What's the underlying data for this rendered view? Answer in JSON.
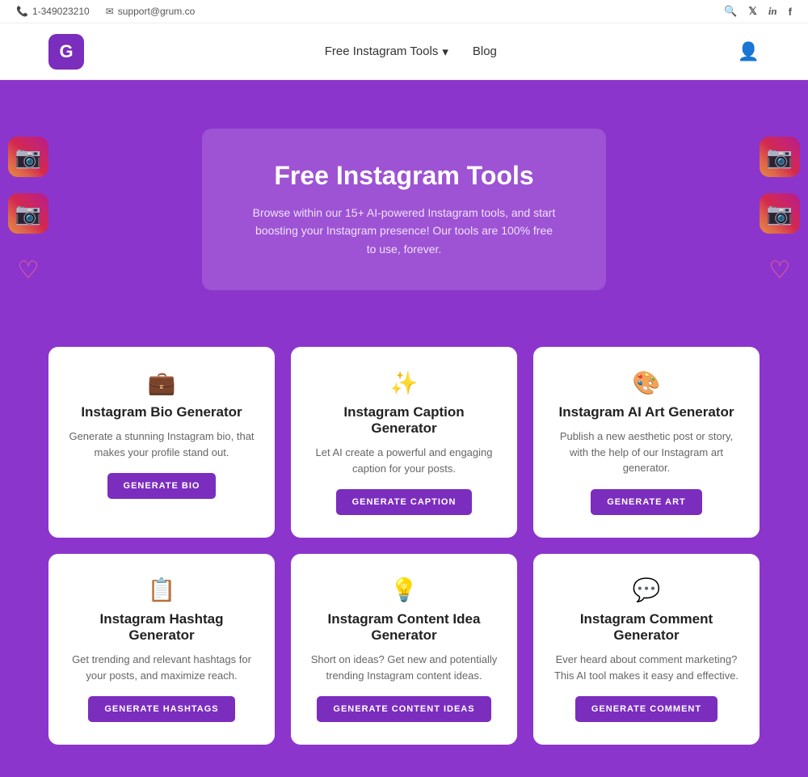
{
  "topbar": {
    "phone": "1-349023210",
    "email": "support@grum.co",
    "phone_icon": "📞",
    "email_icon": "✉"
  },
  "navbar": {
    "logo_letter": "G",
    "menu": {
      "tools_label": "Free Instagram Tools",
      "tools_dropdown": "▾",
      "blog_label": "Blog"
    }
  },
  "hero": {
    "title": "Free Instagram Tools",
    "description": "Browse within our 15+ AI-powered Instagram tools, and start boosting your Instagram presence! Our tools are 100% free to use, forever."
  },
  "cards": [
    {
      "icon": "💼",
      "title": "Instagram Bio Generator",
      "description": "Generate a stunning Instagram bio, that makes your profile stand out.",
      "button_label": "GENERATE BIO"
    },
    {
      "icon": "✨",
      "title": "Instagram Caption Generator",
      "description": "Let AI create a powerful and engaging caption for your posts.",
      "button_label": "GENERATE CAPTION"
    },
    {
      "icon": "🎨",
      "title": "Instagram AI Art Generator",
      "description": "Publish a new aesthetic post or story, with the help of our Instagram art generator.",
      "button_label": "GENERATE ART"
    },
    {
      "icon": "📋",
      "title": "Instagram Hashtag Generator",
      "description": "Get trending and relevant hashtags for your posts, and maximize reach.",
      "button_label": "GENERATE HASHTAGS"
    },
    {
      "icon": "💡",
      "title": "Instagram Content Idea Generator",
      "description": "Short on ideas? Get new and potentially trending Instagram content ideas.",
      "button_label": "GENERATE CONTENT IDEAS"
    },
    {
      "icon": "💬",
      "title": "Instagram Comment Generator",
      "description": "Ever heard about comment marketing? This AI tool makes it easy and effective.",
      "button_label": "GENERATE COMMENT"
    }
  ],
  "social_icons": {
    "search": "🔍",
    "twitter": "𝕏",
    "linkedin": "in",
    "facebook": "f"
  }
}
